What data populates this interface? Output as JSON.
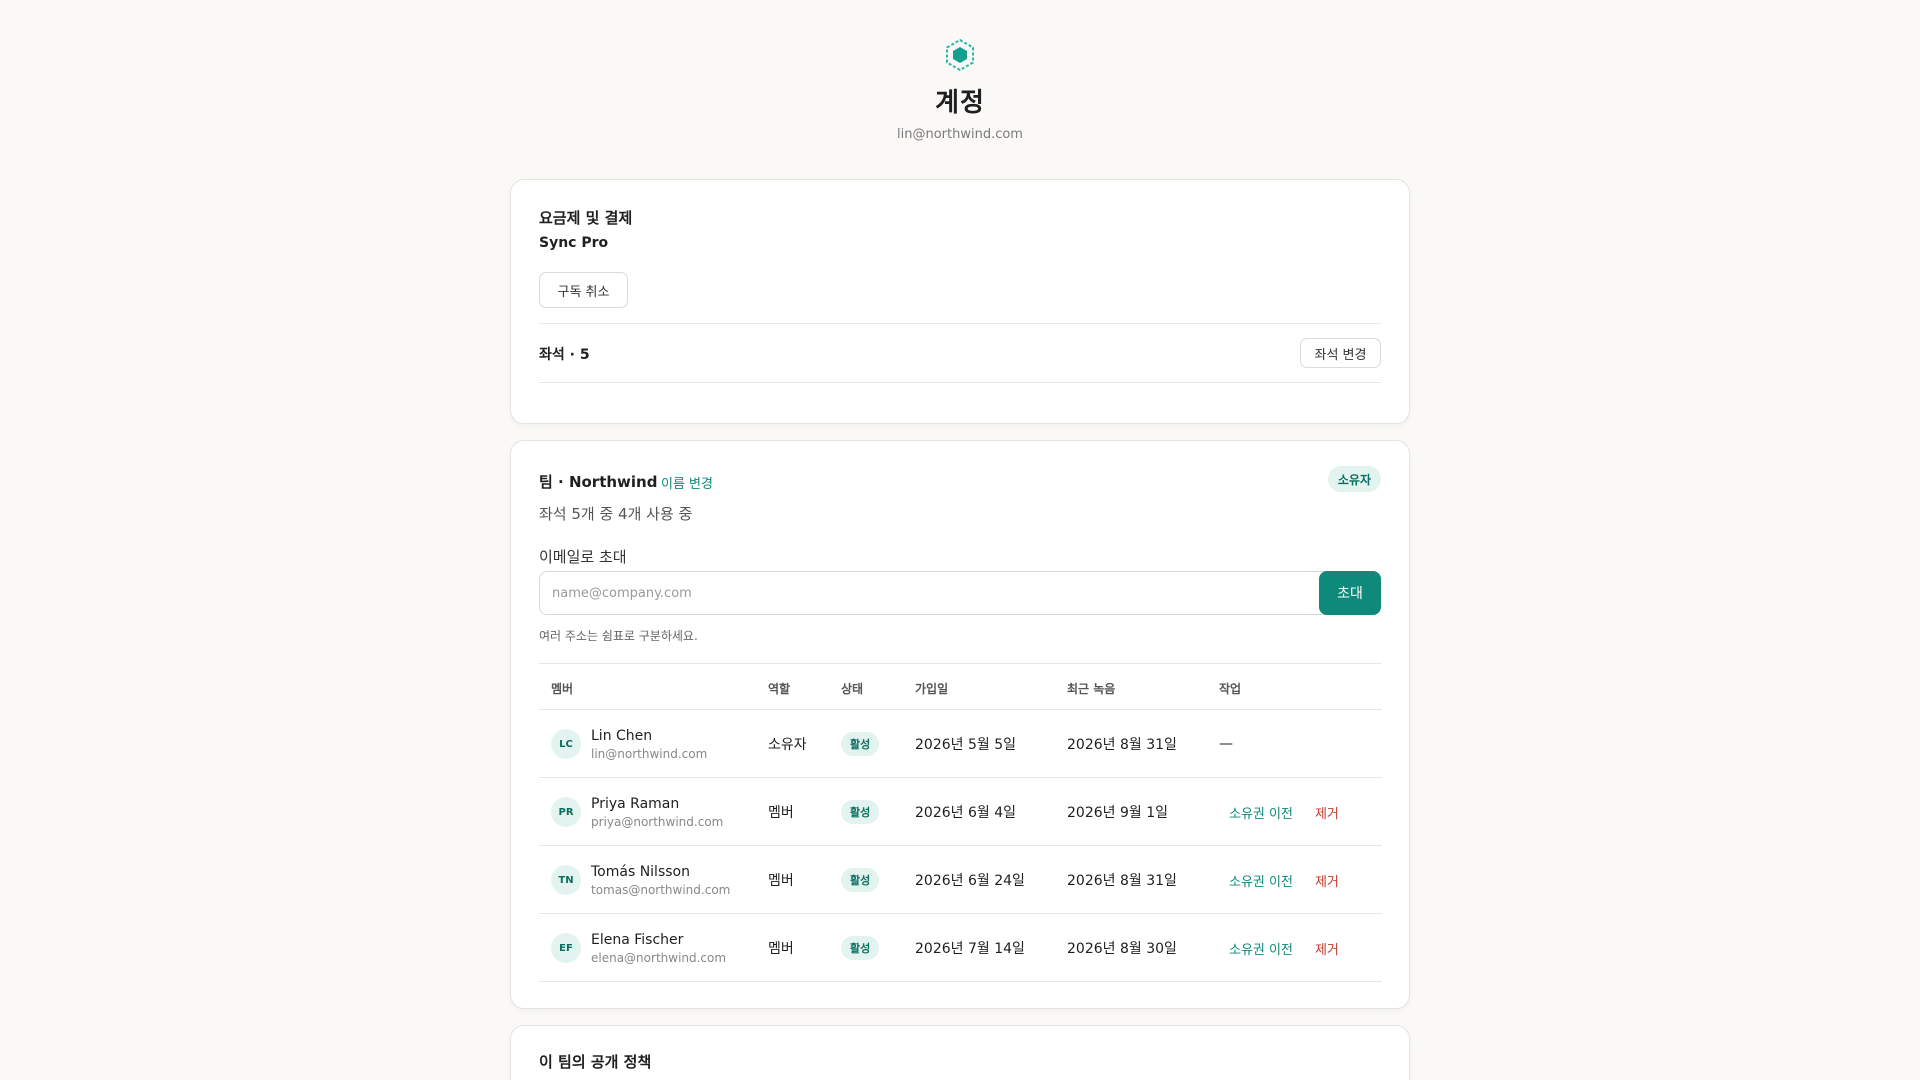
{
  "header": {
    "logo_icon": "hexagon-logo",
    "title": "계정",
    "email": "lin@northwind.com"
  },
  "billing": {
    "title": "요금제 및 결제",
    "plan": "Sync Pro",
    "cancel_label": "구독 취소",
    "seats_label": "좌석 · 5",
    "change_seats_label": "좌석 변경"
  },
  "team": {
    "title": "팀 · Northwind",
    "rename_label": "이름 변경",
    "role_badge": "소유자",
    "usage": "좌석 5개 중 4개 사용 중",
    "invite_label": "이메일로 초대",
    "invite_placeholder": "name@company.com",
    "invite_button": "초대",
    "hint": "여러 주소는 쉼표로 구분하세요.",
    "columns": [
      "멤버",
      "역할",
      "상태",
      "가입일",
      "최근 녹음",
      "작업"
    ],
    "members": [
      {
        "initials": "LC",
        "name": "Lin Chen",
        "email": "lin@northwind.com",
        "role": "소유자",
        "status": "활성",
        "joined": "2026년 5월 5일",
        "last_recording": "2026년 8월 31일",
        "action": "—",
        "transfer": "",
        "remove": ""
      },
      {
        "initials": "PR",
        "name": "Priya Raman",
        "email": "priya@northwind.com",
        "role": "멤버",
        "status": "활성",
        "joined": "2026년 6월 4일",
        "last_recording": "2026년 9월 1일",
        "action": "",
        "transfer": "소유권 이전",
        "remove": "제거"
      },
      {
        "initials": "TN",
        "name": "Tomás Nilsson",
        "email": "tomas@northwind.com",
        "role": "멤버",
        "status": "활성",
        "joined": "2026년 6월 24일",
        "last_recording": "2026년 8월 31일",
        "action": "",
        "transfer": "소유권 이전",
        "remove": "제거"
      },
      {
        "initials": "EF",
        "name": "Elena Fischer",
        "email": "elena@northwind.com",
        "role": "멤버",
        "status": "활성",
        "joined": "2026년 7월 14일",
        "last_recording": "2026년 8월 30일",
        "action": "",
        "transfer": "소유권 이전",
        "remove": "제거"
      }
    ]
  },
  "policy": {
    "title": "이 팀의 공개 정책"
  },
  "colors": {
    "accent": "#0f8a7a",
    "danger": "#c0392b",
    "badge_bg": "#e3f3ef",
    "background": "#faf9f7"
  }
}
